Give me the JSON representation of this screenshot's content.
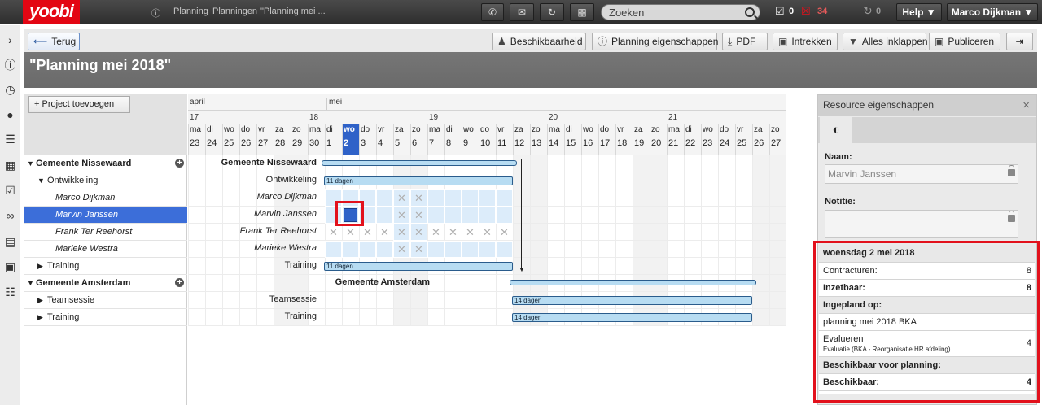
{
  "app": {
    "logo": "yoobi"
  },
  "breadcrumb": [
    "Planning",
    "Planningen",
    "\"Planning mei ..."
  ],
  "topbar": {
    "search_placeholder": "Zoeken",
    "tasks_count": "0",
    "alerts_count": "34",
    "sync_count": "0",
    "help_label": "Help ▼",
    "user_label": "Marco Dijkman ▼"
  },
  "toolbar": {
    "back": "Terug",
    "beschikbaarheid": "Beschikbaarheid",
    "planning_eigenschappen": "Planning eigenschappen",
    "pdf": "PDF",
    "intrekken": "Intrekken",
    "alles_inklappen": "Alles inklappen",
    "publiceren": "Publiceren"
  },
  "page_title": "\"Planning mei 2018\"",
  "tree": {
    "add_project": "Project toevoegen",
    "rows": [
      {
        "label": "Gemeente Nissewaard"
      },
      {
        "label": "Ontwikkeling"
      },
      {
        "label": "Marco Dijkman"
      },
      {
        "label": "Marvin Janssen"
      },
      {
        "label": "Frank Ter Reehorst"
      },
      {
        "label": "Marieke Westra"
      },
      {
        "label": "Training"
      },
      {
        "label": "Gemeente Amsterdam"
      },
      {
        "label": "Teamsessie"
      },
      {
        "label": "Training"
      }
    ]
  },
  "gantt": {
    "months": [
      "april",
      "mei"
    ],
    "weeks": [
      "17",
      "18",
      "19",
      "20",
      "21"
    ],
    "day_names": [
      "ma",
      "di",
      "wo",
      "do",
      "vr",
      "za",
      "zo",
      "ma",
      "di",
      "wo",
      "do",
      "vr",
      "za",
      "zo",
      "ma",
      "di",
      "wo",
      "do",
      "vr",
      "za",
      "zo",
      "ma",
      "di",
      "wo",
      "do",
      "vr",
      "za",
      "zo",
      "ma",
      "di",
      "wo",
      "do",
      "vr",
      "za",
      "zo"
    ],
    "day_nums": [
      "23",
      "24",
      "25",
      "26",
      "27",
      "28",
      "29",
      "30",
      "1",
      "2",
      "3",
      "4",
      "5",
      "6",
      "7",
      "8",
      "9",
      "10",
      "11",
      "12",
      "13",
      "14",
      "15",
      "16",
      "17",
      "18",
      "19",
      "20",
      "21",
      "22",
      "23",
      "24",
      "25",
      "26",
      "27"
    ],
    "row_labels": [
      "Gemeente Nissewaard",
      "Ontwikkeling",
      "Marco Dijkman",
      "Marvin Janssen",
      "Frank Ter Reehorst",
      "Marieke Westra",
      "Training",
      "Gemeente Amsterdam",
      "Teamsessie",
      "Training"
    ],
    "bars": {
      "ontwikkeling": "11 dagen",
      "training1": "11 dagen",
      "teamsessie": "14 dagen",
      "training2": "14 dagen"
    }
  },
  "resource_panel": {
    "title": "Resource eigenschappen",
    "naam_label": "Naam:",
    "naam_value": "Marvin Janssen",
    "notitie_label": "Notitie:",
    "date_header": "woensdag 2 mei 2018",
    "contracturen_label": "Contracturen:",
    "contracturen_value": "8",
    "inzetbaar_label": "Inzetbaar:",
    "inzetbaar_value": "8",
    "ingepland_header": "Ingepland op:",
    "planning_name": "planning mei 2018 BKA",
    "task_name": "Evalueren",
    "task_sub": "Evaluatie (BKA - Reorganisatie HR afdeling)",
    "task_value": "4",
    "beschikbaar_header": "Beschikbaar voor planning:",
    "beschikbaar_label": "Beschikbaar:",
    "beschikbaar_value": "4"
  }
}
